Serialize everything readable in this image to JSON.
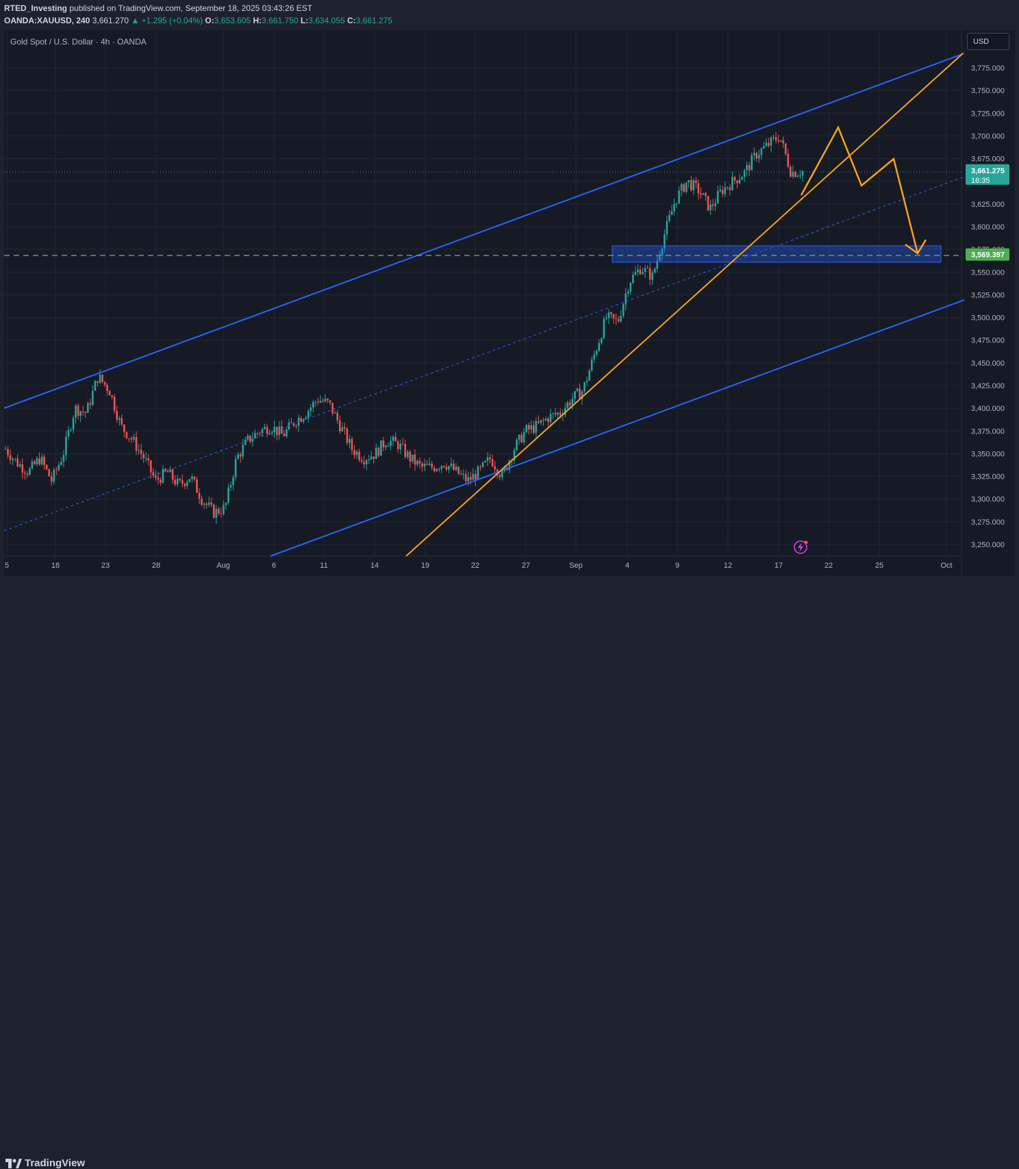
{
  "header": {
    "author": "RTED_Investing",
    "published": "published on TradingView.com, September 18, 2025 03:43:26 EST",
    "symbol": "OANDA:XAUUSD, 240",
    "last": "3,661.270",
    "change": "+1.295 (+0.04%)",
    "open_label": "O:",
    "open": "3,653.605",
    "high_label": "H:",
    "high": "3,661.750",
    "low_label": "L:",
    "low": "3,634.055",
    "close_label": "C:",
    "close": "3,661.275"
  },
  "chart_title": "Gold Spot / U.S. Dollar · 4h · OANDA",
  "currency_button": "USD",
  "price_axis": {
    "ticks": [
      "3,775.000",
      "3,750.000",
      "3,725.000",
      "3,700.000",
      "3,675.000",
      "3,650.000",
      "3,625.000",
      "3,600.000",
      "3,575.000",
      "3,550.000",
      "3,525.000",
      "3,500.000",
      "3,475.000",
      "3,450.000",
      "3,425.000",
      "3,400.000",
      "3,375.000",
      "3,350.000",
      "3,325.000",
      "3,300.000",
      "3,275.000",
      "3,250.000"
    ],
    "current_price": "3,661.275",
    "countdown": "16:35",
    "level_price": "3,569.397"
  },
  "time_axis": {
    "ticks": [
      "5",
      "18",
      "23",
      "28",
      "Aug",
      "6",
      "11",
      "14",
      "19",
      "22",
      "27",
      "Sep",
      "4",
      "9",
      "12",
      "17",
      "22",
      "25",
      "Oct"
    ]
  },
  "colors": {
    "up": "#26a69a",
    "down": "#ef5350",
    "channel": "#2962ff",
    "forecast": "#f7a21b",
    "level": "#4caf50",
    "zone": "#2962ff"
  },
  "footer": {
    "brand": "TradingView"
  },
  "chart_data": {
    "type": "candlestick",
    "symbol": "OANDA:XAUUSD",
    "interval": "4h",
    "ylim": [
      3240,
      3792
    ],
    "price_ticks": [
      3775,
      3750,
      3725,
      3700,
      3675,
      3650,
      3625,
      3600,
      3575,
      3550,
      3525,
      3500,
      3475,
      3450,
      3425,
      3400,
      3375,
      3350,
      3325,
      3300,
      3275,
      3250
    ],
    "x_labels": [
      "5",
      "18",
      "23",
      "28",
      "Aug",
      "6",
      "11",
      "14",
      "19",
      "22",
      "27",
      "Sep",
      "4",
      "9",
      "12",
      "17",
      "22",
      "25",
      "Oct"
    ],
    "close_path": [
      3355,
      3340,
      3330,
      3345,
      3320,
      3350,
      3400,
      3395,
      3435,
      3420,
      3380,
      3365,
      3345,
      3320,
      3330,
      3315,
      3325,
      3300,
      3285,
      3290,
      3345,
      3365,
      3375,
      3380,
      3370,
      3385,
      3395,
      3410,
      3405,
      3380,
      3355,
      3345,
      3350,
      3365,
      3360,
      3345,
      3335,
      3335,
      3340,
      3330,
      3320,
      3330,
      3345,
      3325,
      3355,
      3375,
      3380,
      3390,
      3395,
      3410,
      3420,
      3460,
      3500,
      3495,
      3540,
      3555,
      3545,
      3590,
      3630,
      3650,
      3640,
      3620,
      3640,
      3650,
      3660,
      3680,
      3690,
      3700,
      3660,
      3661
    ],
    "current_price": 3661.275,
    "horizontal_level": 3569.397,
    "zone": {
      "from": 3562,
      "to": 3580
    }
  }
}
